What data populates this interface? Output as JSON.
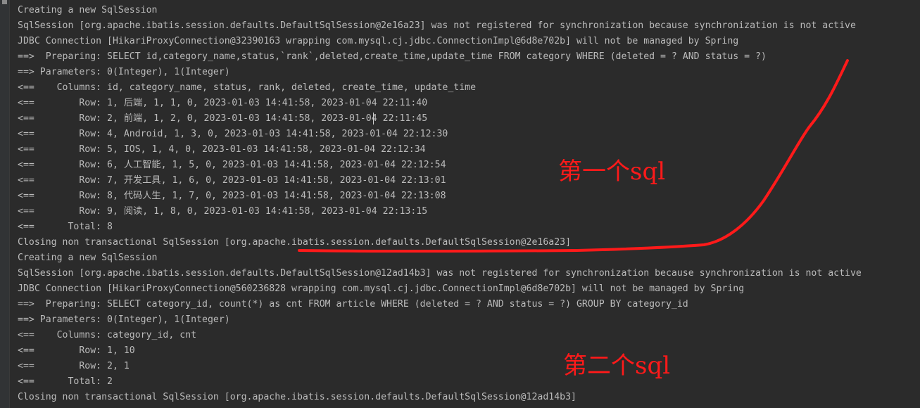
{
  "console": {
    "lines": [
      "Creating a new SqlSession",
      "SqlSession [org.apache.ibatis.session.defaults.DefaultSqlSession@2e16a23] was not registered for synchronization because synchronization is not active",
      "JDBC Connection [HikariProxyConnection@32390163 wrapping com.mysql.cj.jdbc.ConnectionImpl@6d8e702b] will not be managed by Spring",
      "==>  Preparing: SELECT id,category_name,status,`rank`,deleted,create_time,update_time FROM category WHERE (deleted = ? AND status = ?)",
      "==> Parameters: 0(Integer), 1(Integer)",
      "<==    Columns: id, category_name, status, rank, deleted, create_time, update_time",
      "<==        Row: 1, 后端, 1, 1, 0, 2023-01-03 14:41:58, 2023-01-04 22:11:40",
      "<==        Row: 2, 前端, 1, 2, 0, 2023-01-03 14:41:58, 2023-01-04 22:11:45",
      "<==        Row: 4, Android, 1, 3, 0, 2023-01-03 14:41:58, 2023-01-04 22:12:30",
      "<==        Row: 5, IOS, 1, 4, 0, 2023-01-03 14:41:58, 2023-01-04 22:12:34",
      "<==        Row: 6, 人工智能, 1, 5, 0, 2023-01-03 14:41:58, 2023-01-04 22:12:54",
      "<==        Row: 7, 开发工具, 1, 6, 0, 2023-01-03 14:41:58, 2023-01-04 22:13:01",
      "<==        Row: 8, 代码人生, 1, 7, 0, 2023-01-03 14:41:58, 2023-01-04 22:13:08",
      "<==        Row: 9, 阅读, 1, 8, 0, 2023-01-03 14:41:58, 2023-01-04 22:13:15",
      "<==      Total: 8",
      "Closing non transactional SqlSession [org.apache.ibatis.session.defaults.DefaultSqlSession@2e16a23]",
      "Creating a new SqlSession",
      "SqlSession [org.apache.ibatis.session.defaults.DefaultSqlSession@12ad14b3] was not registered for synchronization because synchronization is not active",
      "JDBC Connection [HikariProxyConnection@560236828 wrapping com.mysql.cj.jdbc.ConnectionImpl@6d8e702b] will not be managed by Spring",
      "==>  Preparing: SELECT category_id, count(*) as cnt FROM article WHERE (deleted = ? AND status = ?) GROUP BY category_id",
      "==> Parameters: 0(Integer), 1(Integer)",
      "<==    Columns: category_id, cnt",
      "<==        Row: 1, 10",
      "<==        Row: 2, 1",
      "<==      Total: 2",
      "Closing non transactional SqlSession [org.apache.ibatis.session.defaults.DefaultSqlSession@12ad14b3]"
    ]
  },
  "annotations": {
    "first_sql": "第一个sql",
    "second_sql": "第二个sql"
  },
  "colors": {
    "background": "#2b2b2b",
    "text": "#bbbbbb",
    "annotation": "#ff1a1a"
  }
}
